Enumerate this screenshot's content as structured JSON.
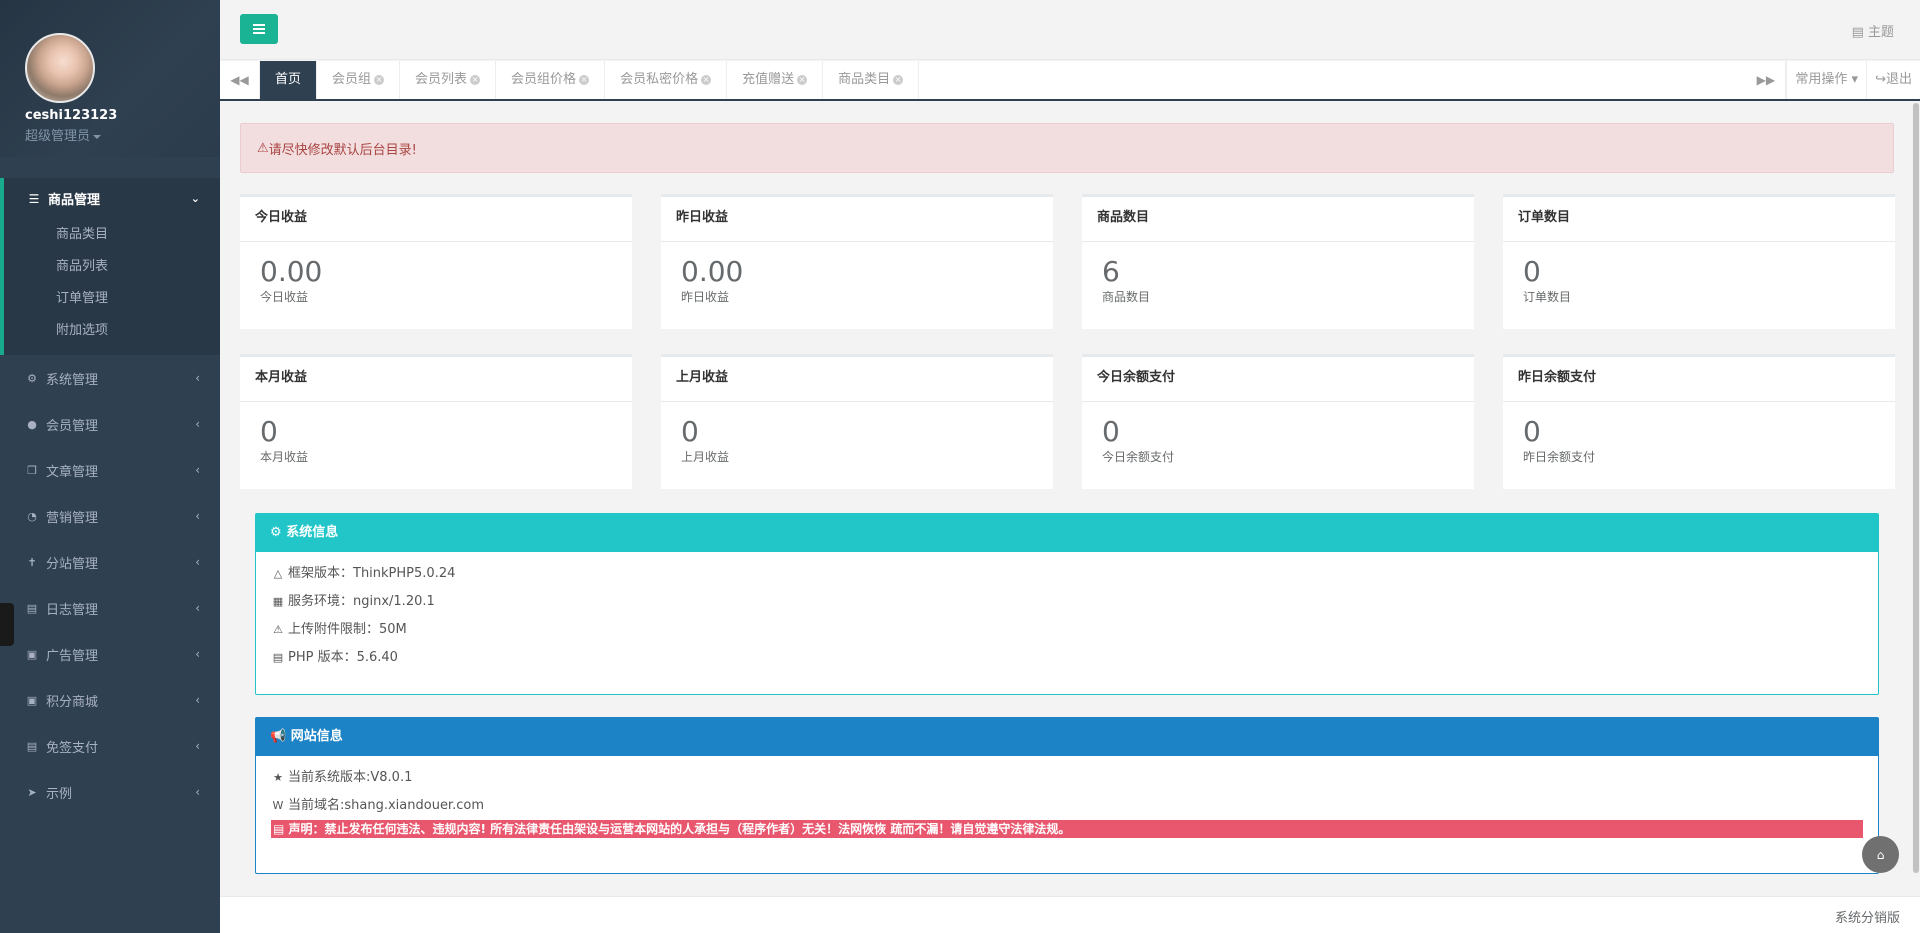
{
  "sidebar": {
    "username": "ceshi123123",
    "role": "超级管理员",
    "open_group": {
      "label": "商品管理",
      "icon": "list-icon",
      "items": [
        "商品类目",
        "商品列表",
        "订单管理",
        "附加选项"
      ]
    },
    "items": [
      {
        "label": "系统管理",
        "icon": "gear-icon"
      },
      {
        "label": "会员管理",
        "icon": "users-icon"
      },
      {
        "label": "文章管理",
        "icon": "copy-icon"
      },
      {
        "label": "营销管理",
        "icon": "pie-chart-icon"
      },
      {
        "label": "分站管理",
        "icon": "child-icon"
      },
      {
        "label": "日志管理",
        "icon": "list-alt-icon"
      },
      {
        "label": "广告管理",
        "icon": "image-icon"
      },
      {
        "label": "积分商城",
        "icon": "cart-icon"
      },
      {
        "label": "免签支付",
        "icon": "credit-card-icon"
      },
      {
        "label": "示例",
        "icon": "send-icon"
      }
    ]
  },
  "header": {
    "theme_label": "主题"
  },
  "tabs": {
    "items": [
      {
        "label": "首页",
        "active": true,
        "closable": false
      },
      {
        "label": "会员组",
        "active": false,
        "closable": true
      },
      {
        "label": "会员列表",
        "active": false,
        "closable": true
      },
      {
        "label": "会员组价格",
        "active": false,
        "closable": true
      },
      {
        "label": "会员私密价格",
        "active": false,
        "closable": true
      },
      {
        "label": "充值赠送",
        "active": false,
        "closable": true
      },
      {
        "label": "商品类目",
        "active": false,
        "closable": true
      }
    ],
    "common_ops": "常用操作",
    "logout": "退出"
  },
  "alert": "请尽快修改默认后台目录!",
  "stats": [
    {
      "title": "今日收益",
      "value": "0.00",
      "label": "今日收益"
    },
    {
      "title": "昨日收益",
      "value": "0.00",
      "label": "昨日收益"
    },
    {
      "title": "商品数目",
      "value": "6",
      "label": "商品数目"
    },
    {
      "title": "订单数目",
      "value": "0",
      "label": "订单数目"
    },
    {
      "title": "本月收益",
      "value": "0",
      "label": "本月收益"
    },
    {
      "title": "上月收益",
      "value": "0",
      "label": "上月收益"
    },
    {
      "title": "今日余额支付",
      "value": "0",
      "label": "今日余额支付"
    },
    {
      "title": "昨日余额支付",
      "value": "0",
      "label": "昨日余额支付"
    }
  ],
  "system_info": {
    "title": "系统信息",
    "color": "#23c6c8",
    "rows": [
      {
        "icon": "sitemap-icon",
        "text": "框架版本：ThinkPHP5.0.24"
      },
      {
        "icon": "windows-icon",
        "text": "服务环境：nginx/1.20.1"
      },
      {
        "icon": "warning-icon",
        "text": "上传附件限制：50M"
      },
      {
        "icon": "credit-card-icon",
        "text": "PHP 版本：5.6.40"
      }
    ]
  },
  "site_info": {
    "title": "网站信息",
    "color": "#1c84c6",
    "rows": [
      {
        "icon": "star-icon",
        "text": "当前系统版本:V8.0.1"
      },
      {
        "icon": "wordpress-icon",
        "text": "当前域名:shang.xiandouer.com"
      }
    ],
    "declaration": "声明：禁止发布任何违法、违规内容! 所有法律责任由架设与运营本网站的人承担与（程序作者）无关！法网恢恢 疏而不漏！请自觉遵守法律法规。",
    "declaration_color": "#e8576e"
  },
  "footer": "系统分销版",
  "colors": {
    "sidebar_bg": "#2f4050",
    "accent": "#1ab394"
  }
}
